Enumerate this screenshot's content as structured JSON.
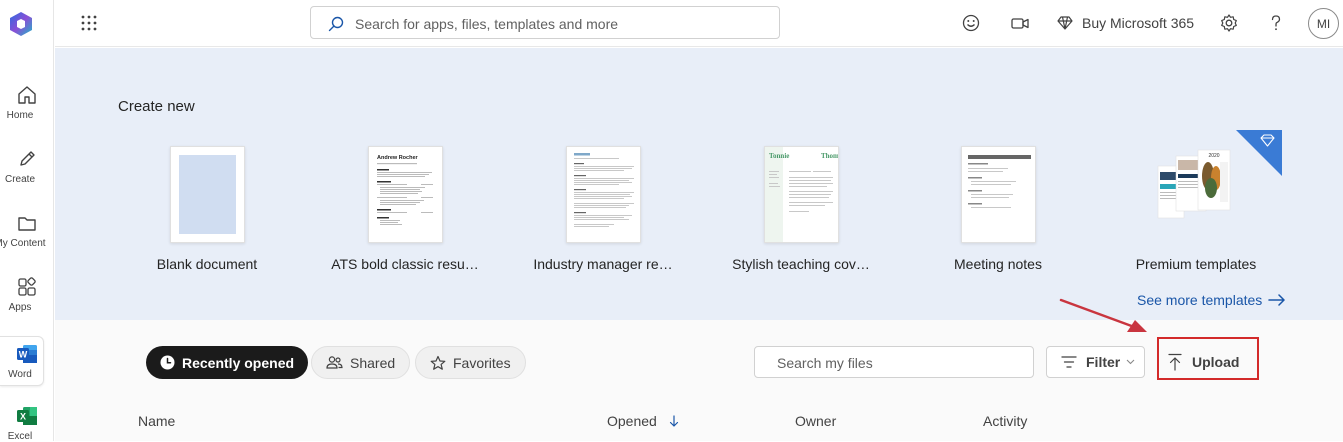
{
  "rail": {
    "items": [
      {
        "label": "Home",
        "icon": "home-icon"
      },
      {
        "label": "Create",
        "icon": "pen-icon"
      },
      {
        "label": "My Content",
        "icon": "folder-icon"
      },
      {
        "label": "Apps",
        "icon": "apps-icon"
      },
      {
        "label": "Word",
        "icon": "word-icon"
      },
      {
        "label": "Excel",
        "icon": "excel-icon"
      }
    ],
    "selected": "Word"
  },
  "topbar": {
    "search_placeholder": "Search for apps, files, templates and more",
    "buy_label": "Buy Microsoft 365",
    "avatar_initials": "MI"
  },
  "create": {
    "title": "Create new",
    "templates": [
      {
        "name": "Blank document",
        "type": "blank"
      },
      {
        "name": "ATS bold classic resu…",
        "type": "resume",
        "heading": "Andrew Rocher"
      },
      {
        "name": "Industry manager re…",
        "type": "resume2"
      },
      {
        "name": "Stylish teaching cov…",
        "type": "cover",
        "heading": "Tonnie Thomsen"
      },
      {
        "name": "Meeting notes",
        "type": "notes"
      },
      {
        "name": "Premium templates",
        "type": "premium",
        "badge_year": "2020"
      }
    ],
    "see_more": "See more templates"
  },
  "files": {
    "filters": [
      {
        "label": "Recently opened",
        "active": true
      },
      {
        "label": "Shared",
        "active": false
      },
      {
        "label": "Favorites",
        "active": false
      }
    ],
    "search_placeholder": "Search my files",
    "filter_label": "Filter",
    "upload_label": "Upload",
    "columns": {
      "name": "Name",
      "opened": "Opened",
      "owner": "Owner",
      "activity": "Activity"
    }
  },
  "colors": {
    "accent": "#1a56a8",
    "banner": "#e8eef8",
    "highlight": "#d32a2a",
    "premium": "#3a7bd5"
  }
}
